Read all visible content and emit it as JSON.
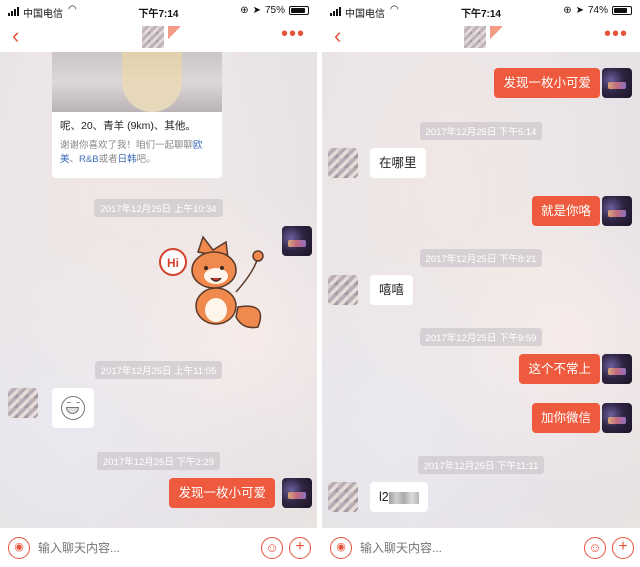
{
  "status": {
    "carrier": "中国电信",
    "time": "下午7:14",
    "battery_left": "75%",
    "battery_right": "74%",
    "battery_left_level": 0.75,
    "battery_right_level": 0.74
  },
  "nav": {
    "back_icon": "chevron-left-icon",
    "more_icon": "more-dots-icon"
  },
  "composer": {
    "placeholder": "输入聊天内容..."
  },
  "left": {
    "profile": {
      "line1": "呢、20、青羊 (9km)、其他。",
      "line2_prefix": "谢谢你喜欢了我！咱们一起聊聊",
      "genre1": "欧美",
      "sep": "、",
      "genre2": "R&B",
      "or": "或者",
      "genre3": "日韩",
      "suffix": "吧。"
    },
    "ts1": "2017年12月25日 上午10:34",
    "ts2": "2017年12月25日 上午11:05",
    "ts3": "2017年12月25日 下午2:29",
    "msg_last": "发现一枚小可爱",
    "sticker_text": "Hi"
  },
  "right": {
    "msg1": "发现一枚小可爱",
    "ts1": "2017年12月25日 下午5:14",
    "msg2": "在哪里",
    "msg3": "就是你咯",
    "ts2": "2017年12月25日 下午8:21",
    "msg4": "嘻嘻",
    "ts3": "2017年12月25日 下午9:59",
    "msg5": "这个不常上",
    "msg6": "加你微信",
    "ts4": "2017年12月25日 下午11:11",
    "msg7_prefix": "l2"
  },
  "colors": {
    "accent": "#ee5a3d",
    "nav_accent": "#e5533b"
  }
}
